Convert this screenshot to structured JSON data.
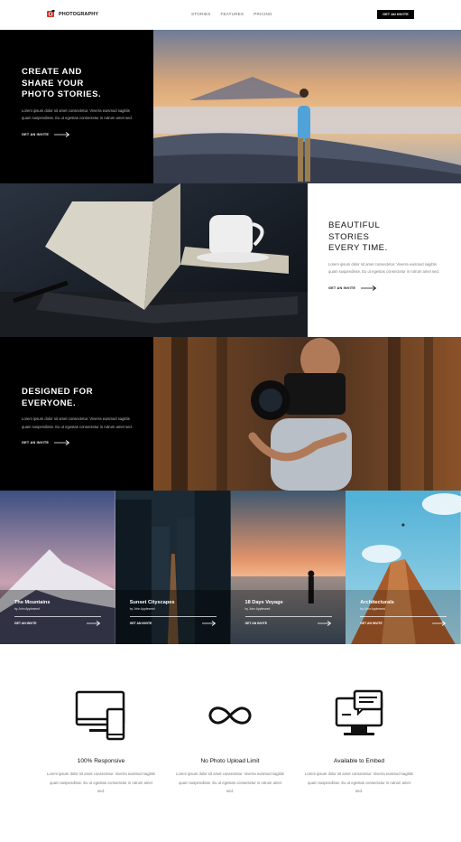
{
  "header": {
    "logo_text": "PHOTOGRAPHY",
    "nav": [
      "STORIES",
      "FEATURES",
      "PRICING"
    ],
    "invite_button": "GET AN INVITE"
  },
  "sections": [
    {
      "title_lines": [
        "CREATE  AND",
        "SHARE YOUR",
        "PHOTO STORIES."
      ],
      "body": "Lorem ipsum dolor sit amet consectetur. Viverra euismod sagittis quam suspendisse. Eu ut egestas consectetur in rutrum amet sed.",
      "cta": "GET AN INVITE"
    },
    {
      "title_lines": [
        "BEAUTIFUL",
        "STORIES",
        "EVERY TIME."
      ],
      "body": "Lorem ipsum dolor sit amet consectetur. Viverra euismod sagittis quam suspendisse. Eu ut egestas consectetur in rutrum amet sed.",
      "cta": "GET AN INVITE"
    },
    {
      "title_lines": [
        "DESIGNED FOR",
        "EVERYONE."
      ],
      "body": "Lorem ipsum dolor sit amet consectetur. Viverra euismod sagittis quam suspendisse. Eu ut egestas consectetur in rutrum amet sed.",
      "cta": "GET AN INVITE"
    }
  ],
  "gallery": [
    {
      "title": "The Mountains",
      "author": "by John Appleseed",
      "cta": "GET AN INVITE"
    },
    {
      "title": "Sunset Cityscapes",
      "author": "by John Appleseed",
      "cta": "GET AN INVITE"
    },
    {
      "title": "18 Days Voyage",
      "author": "by John Appleseed",
      "cta": "GET AN INVITE"
    },
    {
      "title": "Architecturals",
      "author": "by John Appleseed",
      "cta": "GET AN INVITE"
    }
  ],
  "features": [
    {
      "icon": "devices-icon",
      "title": "100% Responsive",
      "body": "Lorem ipsum dolor sit amet consectetur. Viverra euismod sagittis quam suspendisse. Eu ut egestas consectetur in rutrum amet sed."
    },
    {
      "icon": "infinity-icon",
      "title": "No Photo Upload Limit",
      "body": "Lorem ipsum dolor sit amet consectetur. Viverra euismod sagittis quam suspendisse. Eu ut egestas consectetur in rutrum amet sed."
    },
    {
      "icon": "embed-monitor-icon",
      "title": "Available to Embed",
      "body": "Lorem ipsum dolor sit amet consectetur. Viverra euismod sagittis quam suspendisse. Eu ut egestas consectetur in rutrum amet sed."
    }
  ],
  "colors": {
    "accent_red": "#e0322b",
    "black": "#000000",
    "text_gray": "#777777"
  }
}
